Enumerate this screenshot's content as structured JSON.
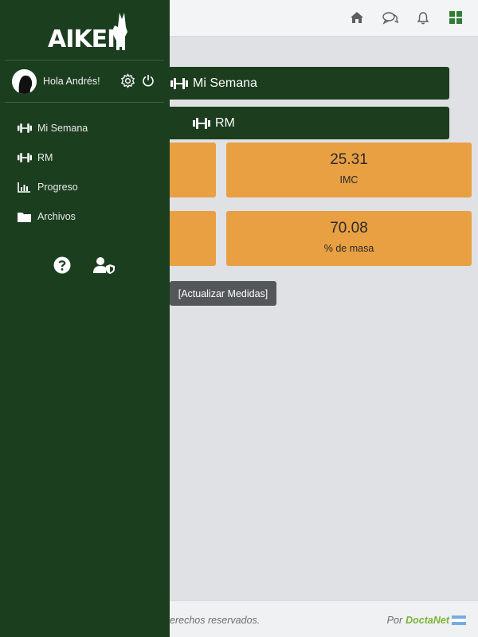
{
  "brand": {
    "logo_text": "AIKEN"
  },
  "user": {
    "greeting": "Hola Andrés!"
  },
  "sidebar": {
    "items": [
      {
        "label": "Mi Semana",
        "icon": "dumbbell-icon"
      },
      {
        "label": "RM",
        "icon": "dumbbell-icon"
      },
      {
        "label": "Progreso",
        "icon": "bar-chart-icon"
      },
      {
        "label": "Archivos",
        "icon": "folder-icon"
      }
    ],
    "bottom_icons": [
      "help-circle-icon",
      "user-shield-icon"
    ]
  },
  "topbar": {
    "icons": [
      "home-icon",
      "chat-icon",
      "bell-icon",
      "grid-icon"
    ]
  },
  "main": {
    "mi_semana_label": "Mi Semana",
    "rm_label": "RM",
    "cards": [
      {
        "value": "25.31",
        "label": "IMC"
      },
      {
        "value": "70.08",
        "label": "% de masa"
      }
    ],
    "update_button": "[Actualizar Medidas]"
  },
  "footer": {
    "rights": "erechos reservados.",
    "by": "Por",
    "brand": "DoctaNet"
  },
  "colors": {
    "sidebar": "#1b3e1f",
    "primary_button": "#1c3d1e",
    "card": "#e8a043",
    "brand_green": "#7bb33a"
  }
}
